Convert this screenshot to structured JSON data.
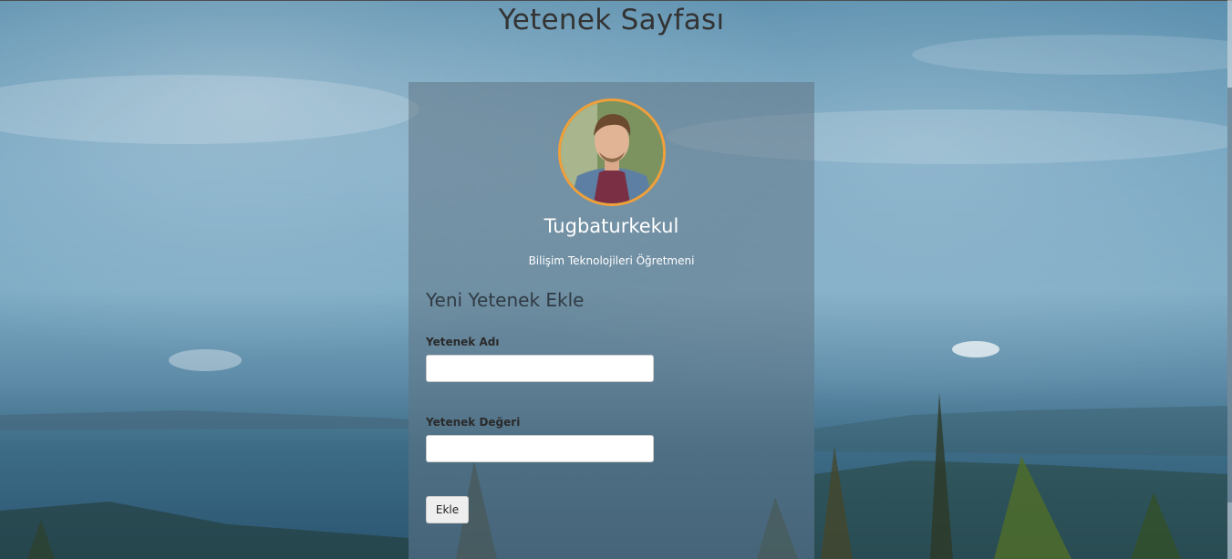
{
  "page": {
    "title": "Yetenek Sayfası"
  },
  "profile": {
    "name": "Tugbaturkekul",
    "role": "Bilişim Teknolojileri Öğretmeni"
  },
  "form": {
    "title": "Yeni Yetenek Ekle",
    "skill_name_label": "Yetenek Adı",
    "skill_name_value": "",
    "skill_value_label": "Yetenek Değeri",
    "skill_value_value": "",
    "submit_label": "Ekle"
  },
  "colors": {
    "avatar_border": "#f0a03a",
    "card_overlay": "rgba(95,115,130,0.52)"
  }
}
